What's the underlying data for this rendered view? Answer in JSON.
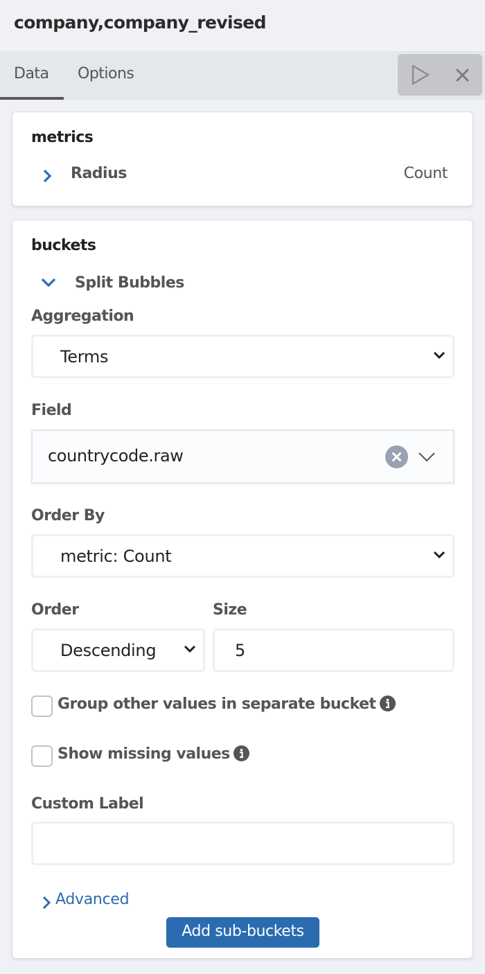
{
  "header": {
    "title": "company,company_revised"
  },
  "tabs": [
    {
      "label": "Data",
      "active": true
    },
    {
      "label": "Options",
      "active": false
    }
  ],
  "actions": {
    "run_icon": "play-icon",
    "close_icon": "close-icon"
  },
  "metrics": {
    "heading": "metrics",
    "items": [
      {
        "title": "Radius",
        "description": "Count",
        "expanded": false,
        "icon": "chevron-right-icon"
      }
    ]
  },
  "buckets": {
    "heading": "buckets",
    "items": [
      {
        "title": "Split Bubbles",
        "expanded": true,
        "icon": "chevron-down-icon",
        "aggregation": {
          "label": "Aggregation",
          "value": "Terms"
        },
        "field": {
          "label": "Field",
          "value": "countrycode.raw"
        },
        "order_by": {
          "label": "Order By",
          "value": "metric: Count"
        },
        "order": {
          "label": "Order",
          "value": "Descending"
        },
        "size": {
          "label": "Size",
          "value": "5"
        },
        "group_other": {
          "label": "Group other values in separate bucket",
          "checked": false
        },
        "show_missing": {
          "label": "Show missing values",
          "checked": false
        },
        "custom_label": {
          "label": "Custom Label",
          "value": "",
          "placeholder": ""
        },
        "advanced_label": "Advanced"
      }
    ],
    "add_button_label": "Add sub-buckets"
  },
  "colors": {
    "accent": "#2b6cb0",
    "background": "#eff1f4"
  }
}
